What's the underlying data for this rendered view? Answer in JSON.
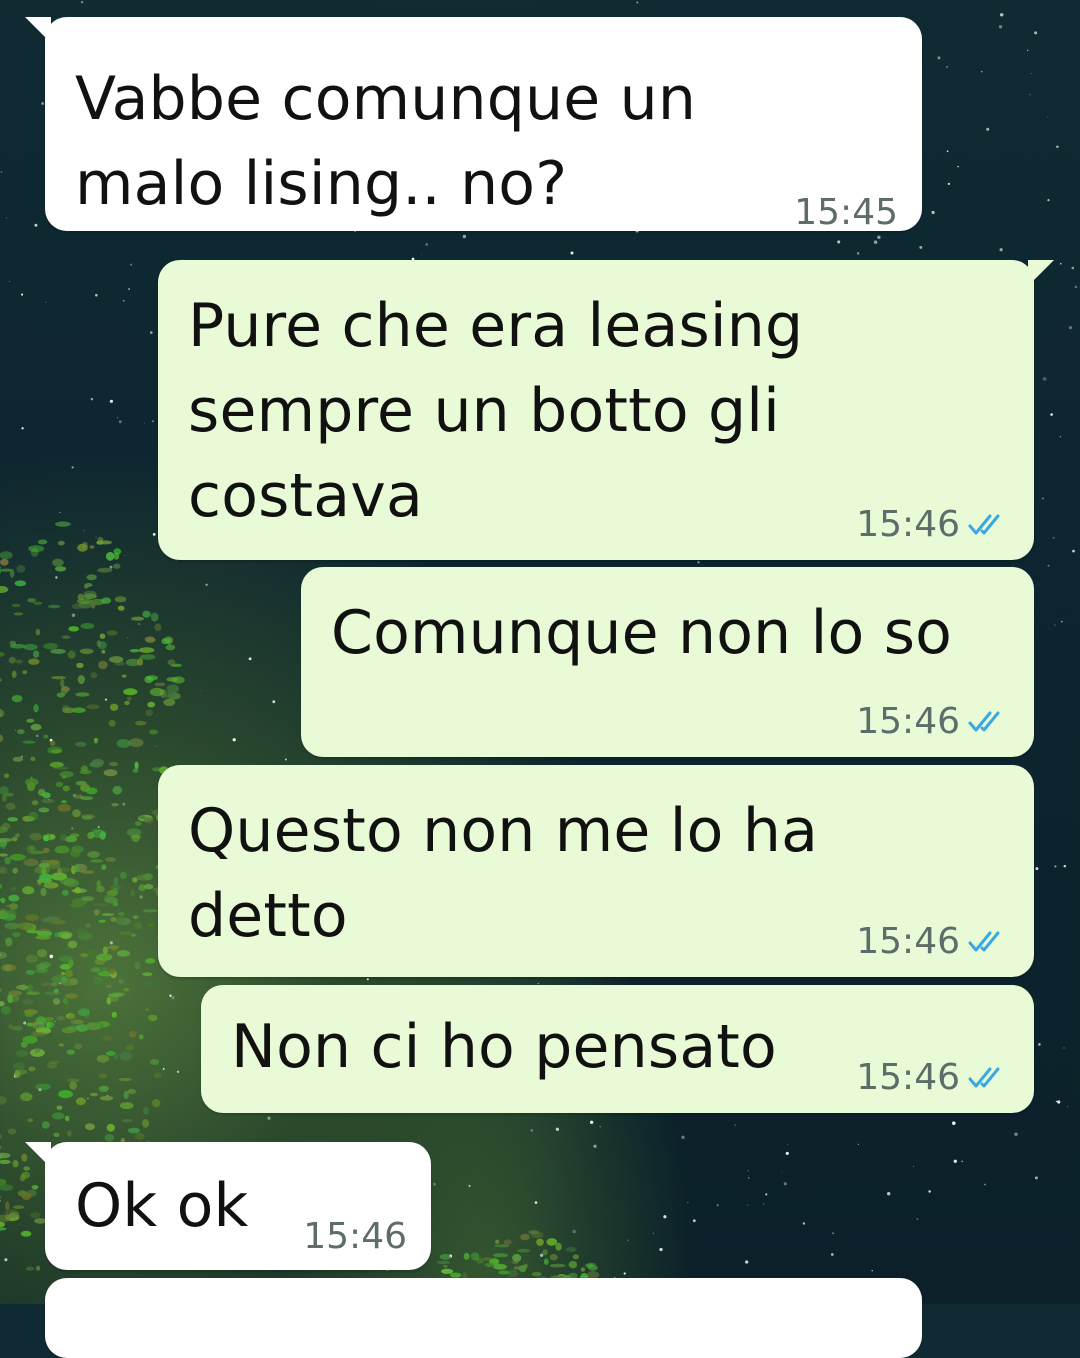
{
  "messages": [
    {
      "direction": "incoming",
      "text": "Vabbe comunque un\nmalo lising.. no?",
      "time": "15:45"
    },
    {
      "direction": "outgoing",
      "text": "Pure che era leasing\nsempre un botto gli\ncostava",
      "time": "15:46",
      "status_icon": "double-check-icon"
    },
    {
      "direction": "outgoing",
      "text": "Comunque non lo so",
      "time": "15:46",
      "status_icon": "double-check-icon"
    },
    {
      "direction": "outgoing",
      "text": "Questo non me lo ha\ndetto",
      "time": "15:46",
      "status_icon": "double-check-icon"
    },
    {
      "direction": "outgoing",
      "text": "Non ci ho pensato",
      "time": "15:46",
      "status_icon": "double-check-icon"
    },
    {
      "direction": "incoming",
      "text": "Ok ok",
      "time": "15:46"
    }
  ],
  "colors": {
    "incoming_bubble": "#ffffff",
    "outgoing_bubble": "#e8fbd6",
    "read_ticks": "#3ba7e3",
    "time_text": "#5f6d6a"
  }
}
